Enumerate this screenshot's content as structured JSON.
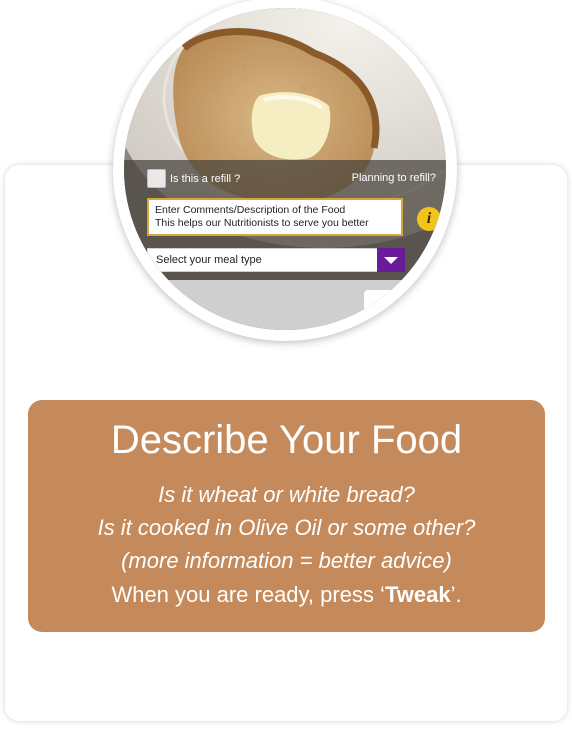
{
  "overlay": {
    "refill_label": "Is this a refill ?",
    "planning_label": "Planning to refill?",
    "comments_line1": "Enter Comments/Description of the Food",
    "comments_line2": "This helps our Nutritionists to serve you better",
    "info_icon_glyph": "i",
    "meal_type_label": "Select your meal type"
  },
  "panel": {
    "title": "Describe Your Food",
    "line1": "Is it wheat or white bread?",
    "line2": "Is it cooked in Olive Oil or some other?",
    "line3": "(more information = better advice)",
    "final_prefix": "When you are ready, press ",
    "final_open_quote": "‘",
    "final_keyword": "Tweak",
    "final_suffix": "’."
  },
  "colors": {
    "panel_bg": "#c48a5b",
    "accent_purple": "#6a1b9a",
    "info_yellow": "#f2c31a",
    "comments_border": "#d4a93a"
  }
}
